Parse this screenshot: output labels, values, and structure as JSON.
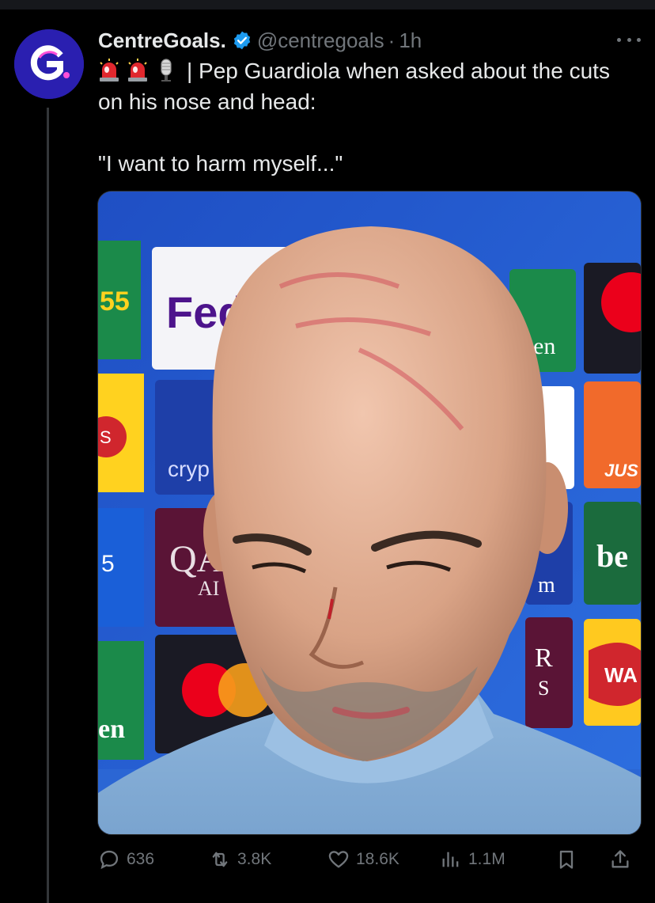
{
  "tweet": {
    "author": {
      "display_name": "CentreGoals.",
      "handle": "@centregoals",
      "avatar_letter": "G",
      "verified": true
    },
    "separator": "·",
    "time": "1h",
    "emoji_prefix": [
      "rotating-light-icon",
      "rotating-light-icon",
      "microphone-icon"
    ],
    "text_line": "| Pep Guardiola when asked about the cuts on his nose and head:",
    "quote": "\"I want to harm myself...\"",
    "media": {
      "description_icon": "photo-press-conference",
      "sponsor_labels": [
        "55",
        "Fed",
        "en",
        "S",
        "cryp",
        "JUS",
        "5",
        "QA",
        "AI",
        "be",
        "m",
        "R",
        "S",
        "WA",
        "en"
      ]
    }
  },
  "actions": {
    "replies": "636",
    "retweets": "3.8K",
    "likes": "18.6K",
    "views": "1.1M"
  },
  "colors": {
    "background": "#000000",
    "text_primary": "#e7e9ea",
    "text_secondary": "#71767b",
    "verified_blue": "#1d9bf0",
    "avatar_blue": "#2a1fb0",
    "divider": "#333639"
  }
}
